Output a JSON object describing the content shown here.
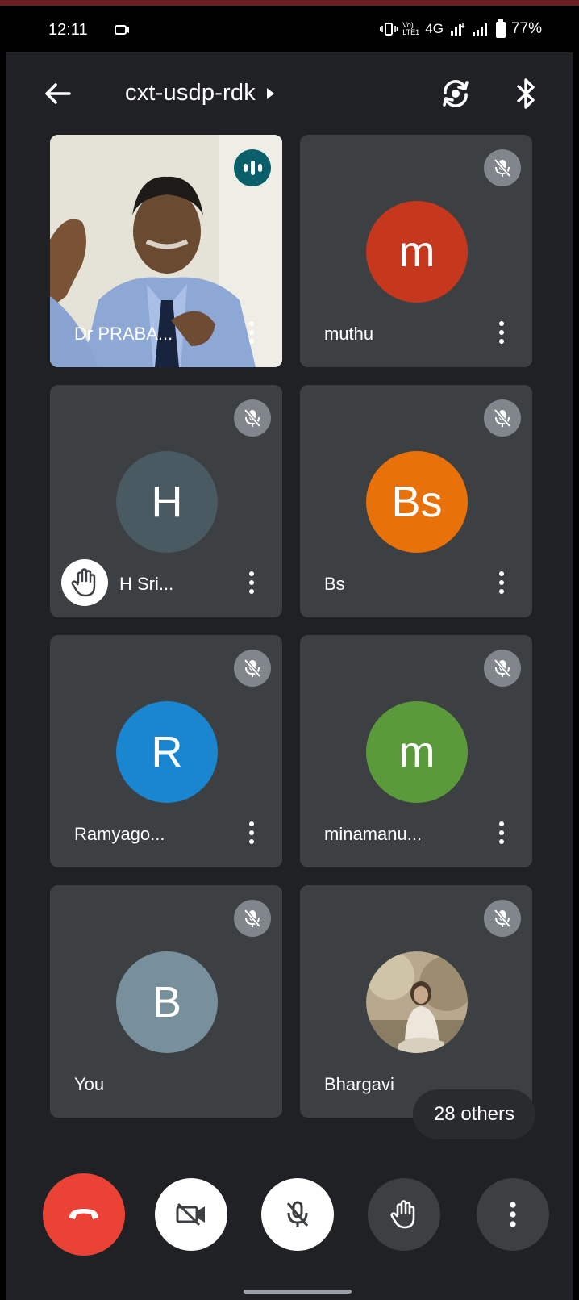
{
  "status_bar": {
    "time": "12:11",
    "network_label": "4G",
    "volte_label": "Vo) LTE1",
    "battery": "77%"
  },
  "app_bar": {
    "meeting_code": "cxt-usdp-rdk"
  },
  "participants": [
    {
      "name": "Dr PRABA...",
      "type": "video",
      "speaking": true
    },
    {
      "name": "muthu",
      "initial": "m",
      "color": "#c5381e",
      "muted": true
    },
    {
      "name": "H Sri...",
      "initial": "H",
      "color": "#4a5a63",
      "muted": true,
      "hand_raised": true
    },
    {
      "name": "Bs",
      "initial": "Bs",
      "color": "#e8710a",
      "muted": true
    },
    {
      "name": "Ramyago...",
      "initial": "R",
      "color": "#1a86d0",
      "muted": true
    },
    {
      "name": "minamanu...",
      "initial": "m",
      "color": "#5a9a3a",
      "muted": true
    },
    {
      "name": "You",
      "initial": "B",
      "color": "#78909c",
      "muted": true
    },
    {
      "name": "Bhargavi",
      "type": "photo",
      "muted": true
    }
  ],
  "others_chip": "28 others",
  "colors": {
    "background": "#202124",
    "tile": "#3c4043",
    "end_call": "#ea4335",
    "speaking": "#0b5f6b",
    "muted_badge": "#80868b"
  },
  "controls": {
    "end_call_icon": "phone-hangup-icon",
    "camera_icon": "camera-off-icon",
    "mic_icon": "mic-off-icon",
    "hand_icon": "raise-hand-icon",
    "more_icon": "more-vert-icon"
  }
}
